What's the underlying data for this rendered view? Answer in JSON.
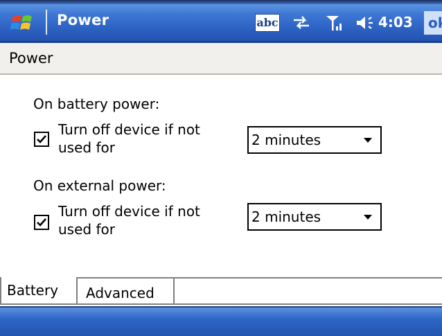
{
  "titlebar": {
    "title": "Power",
    "input_indicator": "abc",
    "clock": "4:03",
    "ok_label": "ok",
    "icons": [
      "windows-start-icon",
      "sync-icon",
      "signal-icon",
      "volume-icon"
    ]
  },
  "page_header": {
    "label": "Power"
  },
  "battery_section": {
    "heading": "On battery power:",
    "checkbox_label_line1": "Turn off device if not",
    "checkbox_label_line2": "used for",
    "checked": true,
    "dropdown_value": "2 minutes"
  },
  "external_section": {
    "heading": "On external power:",
    "checkbox_label_line1": "Turn off device if not",
    "checkbox_label_line2": "used for",
    "checked": true,
    "dropdown_value": "2 minutes"
  },
  "tabs": [
    {
      "label": "Battery",
      "selected": false
    },
    {
      "label": "Advanced",
      "selected": true
    }
  ],
  "colors": {
    "titlebar": "#2a5fc0",
    "header_bg": "#f1f0ec",
    "text": "#000000"
  }
}
